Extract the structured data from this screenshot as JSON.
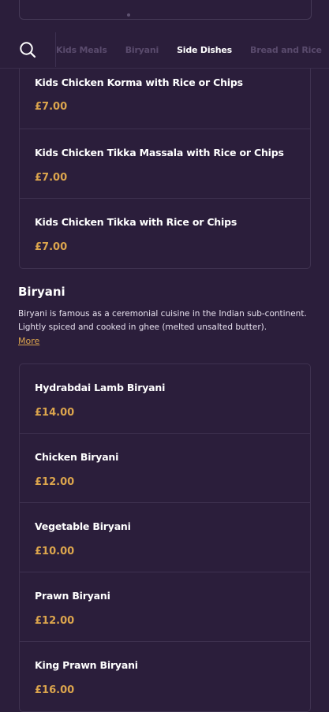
{
  "nav": {
    "tabs": [
      {
        "label": "Kids Meals",
        "active": false
      },
      {
        "label": "Biryani",
        "active": false
      },
      {
        "label": "Side Dishes",
        "active": true
      },
      {
        "label": "Bread and Rice",
        "active": false
      }
    ]
  },
  "kids_items": [
    {
      "name": "Kids Chicken Korma with Rice or Chips",
      "price": "£7.00"
    },
    {
      "name": "Kids Chicken Tikka Massala with Rice or Chips",
      "price": "£7.00"
    },
    {
      "name": "Kids Chicken Tikka with Rice or Chips",
      "price": "£7.00"
    }
  ],
  "biryani_section": {
    "title": "Biryani",
    "description": "Biryani is famous as a ceremonial cuisine in the Indian sub-continent. Lightly spiced and cooked in ghee (melted unsalted butter).",
    "more_label": "More",
    "items": [
      {
        "name": "Hydrabdai Lamb Biryani",
        "price": "£14.00"
      },
      {
        "name": "Chicken Biryani",
        "price": "£12.00"
      },
      {
        "name": "Vegetable Biryani",
        "price": "£10.00"
      },
      {
        "name": "Prawn Biryani",
        "price": "£12.00"
      },
      {
        "name": "King Prawn Biryani",
        "price": "£16.00"
      }
    ]
  },
  "colors": {
    "background": "#2b1e3b",
    "price": "#dca54d",
    "border": "#3f3250",
    "inactive_tab": "#5a4b6d"
  },
  "icons": {
    "search": "search-icon"
  }
}
